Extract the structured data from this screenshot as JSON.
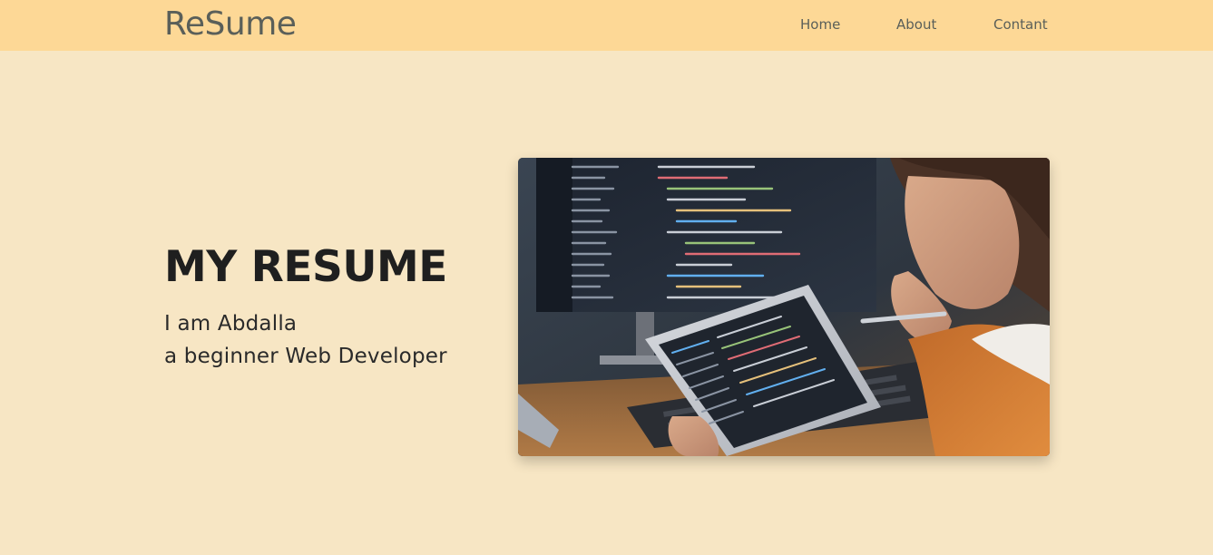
{
  "navbar": {
    "brand": "ReSume",
    "links": [
      "Home",
      "About",
      "Contant"
    ]
  },
  "hero": {
    "title": "MY RESUME",
    "line1": "I am Abdalla",
    "line2": "a beginner Web Developer",
    "image": {
      "description_icon": "developer-photo"
    }
  },
  "colors": {
    "navbar_bg": "#fdd896",
    "page_bg": "#f7e6c4",
    "brand_text": "#5a5f59",
    "title_text": "#1f1f1f"
  }
}
